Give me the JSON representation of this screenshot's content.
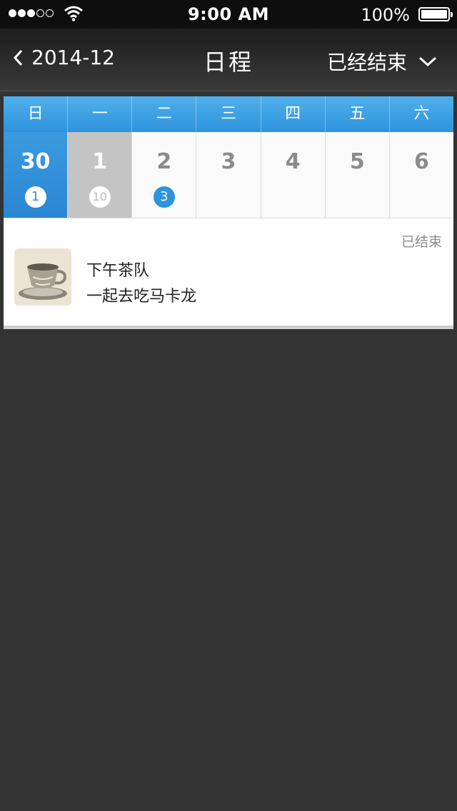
{
  "status_bar": {
    "time": "9:00 AM",
    "battery": "100%",
    "signal_dots": 5,
    "signal_filled": 3
  },
  "nav": {
    "back_label": "2014-12",
    "title": "日程",
    "filter_label": "已经结束"
  },
  "calendar": {
    "weekdays": [
      "日",
      "一",
      "二",
      "三",
      "四",
      "五",
      "六"
    ],
    "days": [
      {
        "num": "30",
        "badge": "1"
      },
      {
        "num": "1",
        "badge": "10"
      },
      {
        "num": "2",
        "badge": "3"
      },
      {
        "num": "3",
        "badge": ""
      },
      {
        "num": "4",
        "badge": ""
      },
      {
        "num": "5",
        "badge": ""
      },
      {
        "num": "6",
        "badge": ""
      }
    ]
  },
  "event": {
    "status": "已结束",
    "title": "下午茶队",
    "description": "一起去吃马卡龙",
    "thumbnail_icon": "teacup-image"
  },
  "colors": {
    "accent": "#2d93dc",
    "background": "#333333",
    "selected_day": "#2a86d4",
    "past_day": "#c4c4c4"
  }
}
